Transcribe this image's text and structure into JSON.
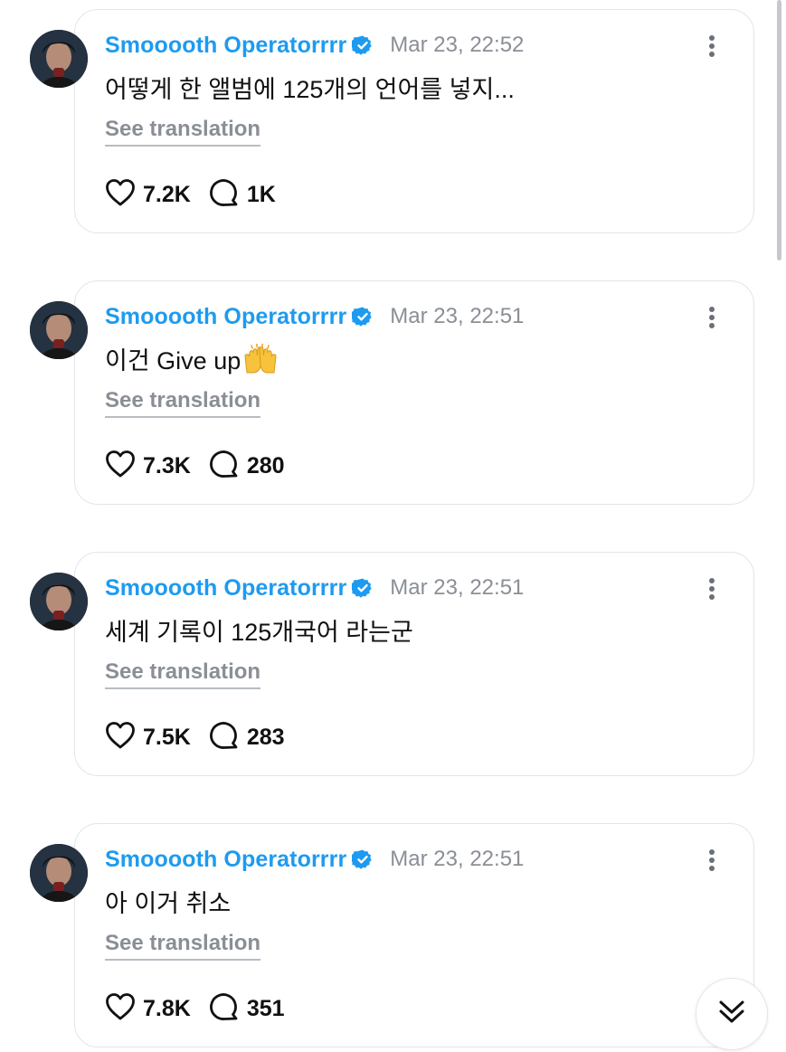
{
  "posts": [
    {
      "username": "Smooooth Operatorrrr",
      "timestamp": "Mar 23, 22:52",
      "text": "어떻게 한 앨범에 125개의 언어를 넣지...",
      "translate_label": "See translation",
      "likes": "7.2K",
      "replies": "1K"
    },
    {
      "username": "Smooooth Operatorrrr",
      "timestamp": "Mar 23, 22:51",
      "text": "이건 Give up",
      "emoji": "raising-hands-emoji",
      "translate_label": "See translation",
      "likes": "7.3K",
      "replies": "280"
    },
    {
      "username": "Smooooth Operatorrrr",
      "timestamp": "Mar 23, 22:51",
      "text": "세계 기록이 125개국어 라는군",
      "translate_label": "See translation",
      "likes": "7.5K",
      "replies": "283"
    },
    {
      "username": "Smooooth Operatorrrr",
      "timestamp": "Mar 23, 22:51",
      "text": "아 이거 취소",
      "translate_label": "See translation",
      "likes": "7.8K",
      "replies": "351"
    }
  ],
  "icons": {
    "verified": "verified-badge-icon",
    "more": "more-vertical-icon",
    "like": "heart-icon",
    "reply": "comment-bubble-icon",
    "scroll": "double-chevron-down-icon"
  },
  "colors": {
    "username": "#1d9bf0",
    "verified": "#1d9bf0",
    "muted": "#8a8f96",
    "text": "#111111",
    "border": "#e3e5e8"
  }
}
